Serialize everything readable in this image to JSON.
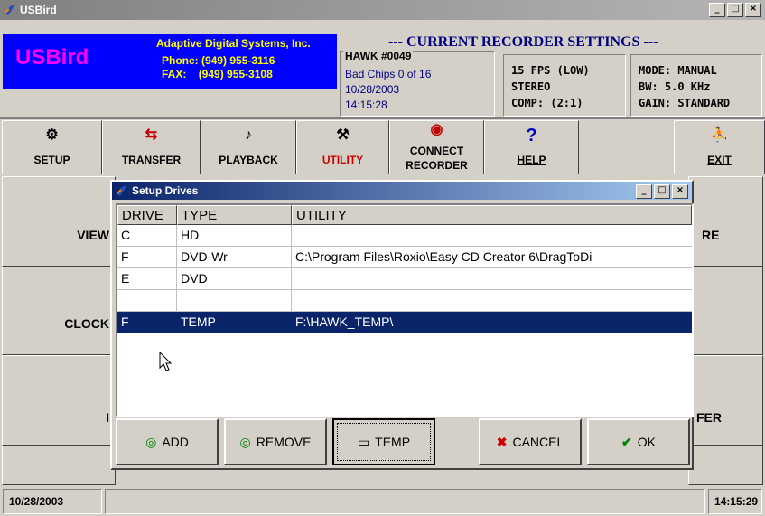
{
  "window": {
    "title": "USBird",
    "controls": [
      "_",
      "□",
      "×"
    ]
  },
  "brand": {
    "name": "USBird",
    "company": "Adaptive Digital Systems, Inc.",
    "phone": "Phone: (949) 955-3116",
    "fax_label": "FAX:",
    "fax_number": "(949) 955-3108"
  },
  "settings": {
    "title": "--- CURRENT RECORDER SETTINGS ---",
    "recorder_name": "HAWK #0049",
    "bad_chips": "Bad Chips 0 of 16",
    "date": "10/28/2003",
    "time": "14:15:28",
    "fps": "15 FPS (LOW)",
    "stereo": "STEREO",
    "comp": "COMP: (2:1)",
    "mode": "MODE: MANUAL",
    "bw": "BW: 5.0 KHz",
    "gain": "GAIN: STANDARD"
  },
  "toolbar": {
    "setup": "SETUP",
    "transfer": "TRANSFER",
    "playback": "PLAYBACK",
    "utility": "UTILITY",
    "connect1": "CONNECT",
    "connect2": "RECORDER",
    "help": "HELP",
    "exit": "EXIT",
    "utility_color": "#cc0000"
  },
  "main": {
    "view": "VIEW",
    "clock": "CLOCK",
    "re": "RE",
    "fer": "FER",
    "l": "I"
  },
  "status": {
    "date": "10/28/2003",
    "time": "14:15:29"
  },
  "dialog": {
    "title": "Setup Drives",
    "columns": [
      "DRIVE",
      "TYPE",
      "UTILITY"
    ],
    "rows": [
      {
        "drive": "C",
        "type": "HD",
        "utility": ""
      },
      {
        "drive": "F",
        "type": "DVD-Wr",
        "utility": "C:\\Program Files\\Roxio\\Easy CD Creator 6\\DragToDi"
      },
      {
        "drive": "E",
        "type": "DVD",
        "utility": ""
      },
      {
        "drive": "",
        "type": "",
        "utility": ""
      },
      {
        "drive": "F",
        "type": "TEMP",
        "utility": "F:\\HAWK_TEMP\\"
      }
    ],
    "selected_row": 4,
    "buttons": {
      "add": "ADD",
      "remove": "REMOVE",
      "temp": "TEMP",
      "cancel": "CANCEL",
      "ok": "OK"
    }
  }
}
